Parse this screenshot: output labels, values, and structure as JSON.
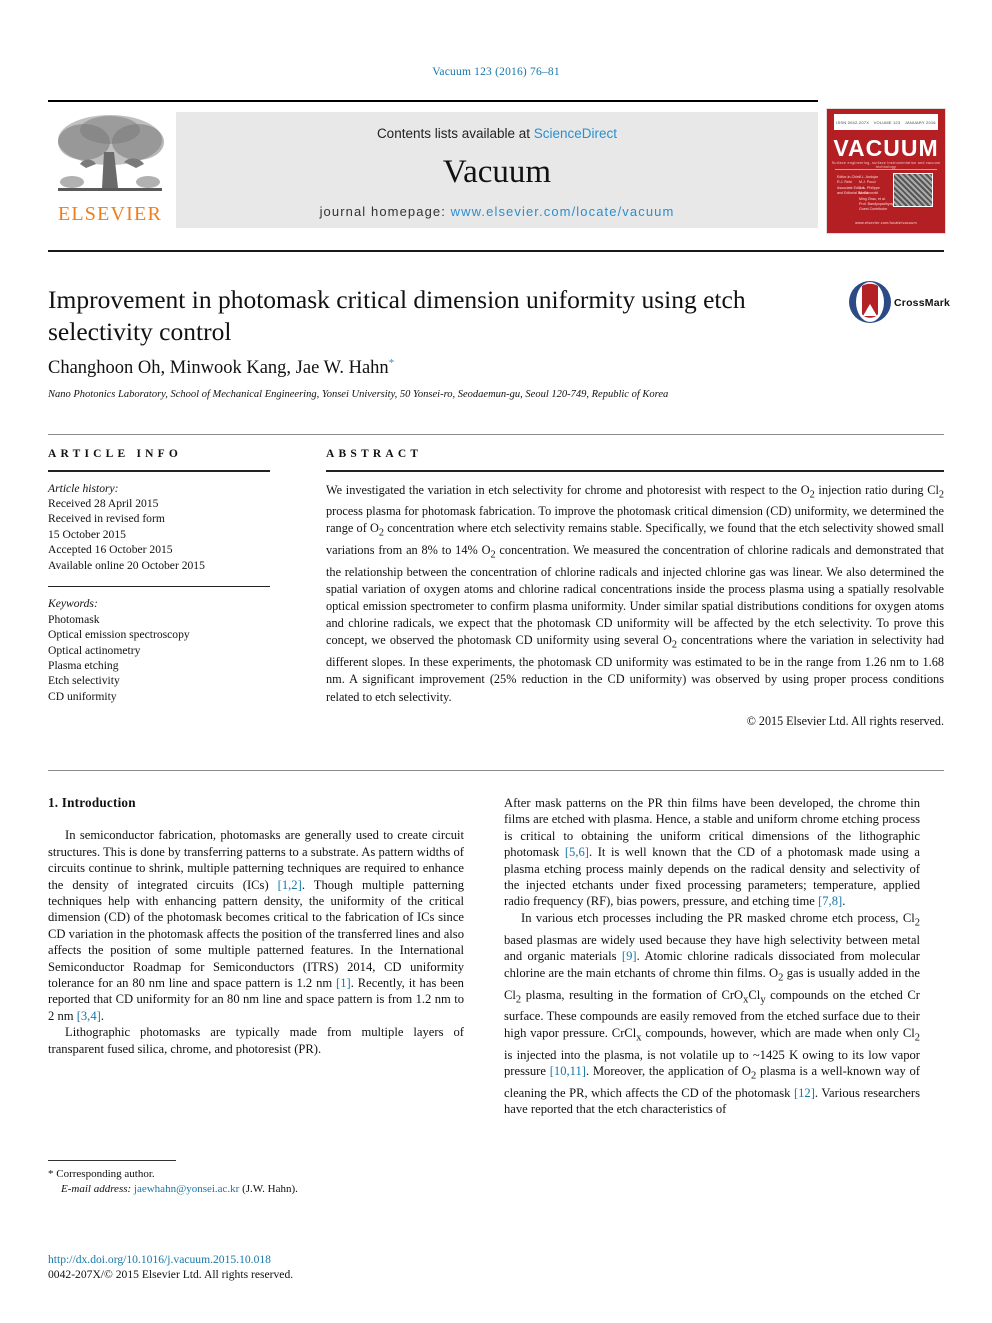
{
  "running_head": "Vacuum 123 (2016) 76–81",
  "masthead": {
    "publisher_name": "ELSEVIER",
    "contents_prefix": "Contents lists available at ",
    "contents_link": "ScienceDirect",
    "journal_name": "Vacuum",
    "homepage_prefix": "journal homepage: ",
    "homepage_url": "www.elsevier.com/locate/vacuum",
    "cover": {
      "title": "VACUUM",
      "top_left": "ISSN 0042-207X",
      "top_mid": "VOLUME 123",
      "top_right": "JANUARY 2016",
      "subtitle": "Surface engineering, surface instrumentation and vacuum technology",
      "editors_col1": "Editor-in-Chief\nR.J. Reid\nAssociate Editors\nand Editorial Board",
      "editors_col2": "J.L. Andujar\nM.J. Pucci\nJ.-L. Philippe\nM. Sancrotti\nMing Zhao, et al.\nProf. Bandyopadhyay\nGuest Contributor",
      "footer": "www.elsevier.com/locate/vacuum"
    }
  },
  "article": {
    "title": "Improvement in photomask critical dimension uniformity using etch selectivity control",
    "authors": "Changhoon Oh, Minwook Kang, Jae W. Hahn",
    "corresponding_marker": "*",
    "affiliation": "Nano Photonics Laboratory, School of Mechanical Engineering, Yonsei University, 50 Yonsei-ro, Seodaemun-gu, Seoul 120-749, Republic of Korea",
    "crossmark_label": "CrossMark"
  },
  "article_info": {
    "heading": "ARTICLE INFO",
    "history_label": "Article history:",
    "history": [
      "Received 28 April 2015",
      "Received in revised form",
      "15 October 2015",
      "Accepted 16 October 2015",
      "Available online 20 October 2015"
    ],
    "keywords_label": "Keywords:",
    "keywords": [
      "Photomask",
      "Optical emission spectroscopy",
      "Optical actinometry",
      "Plasma etching",
      "Etch selectivity",
      "CD uniformity"
    ]
  },
  "abstract": {
    "heading": "ABSTRACT",
    "body": "We investigated the variation in etch selectivity for chrome and photoresist with respect to the O2 injection ratio during Cl2 process plasma for photomask fabrication. To improve the photomask critical dimension (CD) uniformity, we determined the range of O2 concentration where etch selectivity remains stable. Specifically, we found that the etch selectivity showed small variations from an 8% to 14% O2 concentration. We measured the concentration of chlorine radicals and demonstrated that the relationship between the concentration of chlorine radicals and injected chlorine gas was linear. We also determined the spatial variation of oxygen atoms and chlorine radical concentrations inside the process plasma using a spatially resolvable optical emission spectrometer to confirm plasma uniformity. Under similar spatial distributions conditions for oxygen atoms and chlorine radicals, we expect that the photomask CD uniformity will be affected by the etch selectivity. To prove this concept, we observed the photomask CD uniformity using several O2 concentrations where the variation in selectivity had different slopes. In these experiments, the photomask CD uniformity was estimated to be in the range from 1.26 nm to 1.68 nm. A significant improvement (25% reduction in the CD uniformity) was observed by using proper process conditions related to etch selectivity.",
    "copyright": "© 2015 Elsevier Ltd. All rights reserved."
  },
  "body": {
    "section_number_title": "1. Introduction",
    "left_paragraphs": [
      "In semiconductor fabrication, photomasks are generally used to create circuit structures. This is done by transferring patterns to a substrate. As pattern widths of circuits continue to shrink, multiple patterning techniques are required to enhance the density of integrated circuits (ICs) [1,2]. Though multiple patterning techniques help with enhancing pattern density, the uniformity of the critical dimension (CD) of the photomask becomes critical to the fabrication of ICs since CD variation in the photomask affects the position of the transferred lines and also affects the position of some multiple patterned features. In the International Semiconductor Roadmap for Semiconductors (ITRS) 2014, CD uniformity tolerance for an 80 nm line and space pattern is 1.2 nm [1]. Recently, it has been reported that CD uniformity for an 80 nm line and space pattern is from 1.2 nm to 2 nm [3,4].",
      "Lithographic photomasks are typically made from multiple layers of transparent fused silica, chrome, and photoresist (PR)."
    ],
    "right_paragraphs": [
      "After mask patterns on the PR thin films have been developed, the chrome thin films are etched with plasma. Hence, a stable and uniform chrome etching process is critical to obtaining the uniform critical dimensions of the lithographic photomask [5,6]. It is well known that the CD of a photomask made using a plasma etching process mainly depends on the radical density and selectivity of the injected etchants under fixed processing parameters; temperature, applied radio frequency (RF), bias powers, pressure, and etching time [7,8].",
      "In various etch processes including the PR masked chrome etch process, Cl2 based plasmas are widely used because they have high selectivity between metal and organic materials [9]. Atomic chlorine radicals dissociated from molecular chlorine are the main etchants of chrome thin films. O2 gas is usually added in the Cl2 plasma, resulting in the formation of CrOxCly compounds on the etched Cr surface. These compounds are easily removed from the etched surface due to their high vapor pressure. CrClx compounds, however, which are made when only Cl2 is injected into the plasma, is not volatile up to ~1425 K owing to its low vapor pressure [10,11]. Moreover, the application of O2 plasma is a well-known way of cleaning the PR, which affects the CD of the photomask [12]. Various researchers have reported that the etch characteristics of"
    ]
  },
  "footnote": {
    "star": "*",
    "corresponding": "Corresponding author.",
    "email_label": "E-mail address:",
    "email": "jaewhahn@yonsei.ac.kr",
    "email_owner": "(J.W. Hahn)."
  },
  "doi_block": {
    "doi_url": "http://dx.doi.org/10.1016/j.vacuum.2015.10.018",
    "issn_line": "0042-207X/© 2015 Elsevier Ltd. All rights reserved."
  },
  "colors": {
    "link_blue": "#1877a8",
    "sd_blue": "#2a8fd0",
    "elsevier_orange": "#ef7d1a",
    "cover_red": "#b41f24",
    "band_gray": "#e8e8e8"
  }
}
